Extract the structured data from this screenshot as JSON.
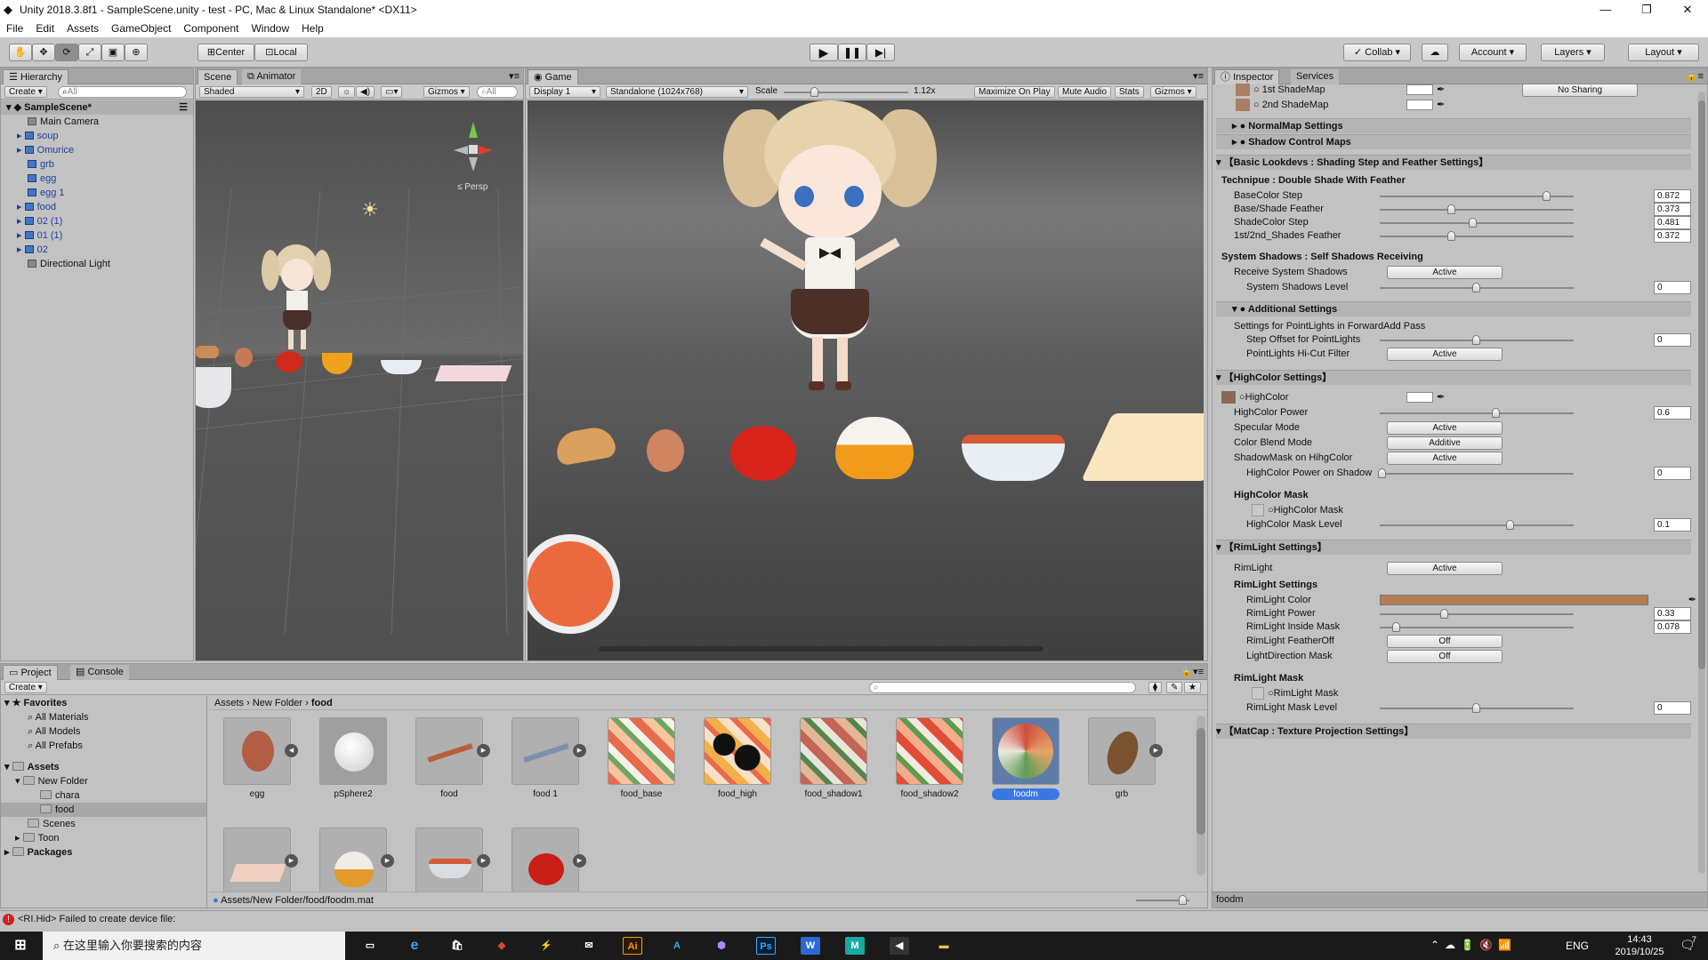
{
  "window": {
    "title": "Unity 2018.3.8f1 - SampleScene.unity - test - PC, Mac & Linux Standalone* <DX11>",
    "min": "—",
    "max": "❐",
    "close": "✕"
  },
  "menu": [
    "File",
    "Edit",
    "Assets",
    "GameObject",
    "Component",
    "Window",
    "Help"
  ],
  "toolbar": {
    "pivot": "Center",
    "space": "Local",
    "collab": "Collab",
    "account": "Account",
    "layers": "Layers",
    "layout": "Layout"
  },
  "hierarchy": {
    "tab": "Hierarchy",
    "create": "Create",
    "search": "All",
    "scene": "SampleScene*",
    "items": [
      "Main Camera",
      "soup",
      "Omurice",
      "grb",
      "egg",
      "egg 1",
      "food",
      "02 (1)",
      "01 (1)",
      "02",
      "Directional Light"
    ]
  },
  "scene": {
    "tab": "Scene",
    "tab2": "Animator",
    "mode": "Shaded",
    "twod": "2D",
    "gizmos": "Gizmos",
    "search": "All",
    "persp": "Persp"
  },
  "game": {
    "tab": "Game",
    "display": "Display 1",
    "res": "Standalone (1024x768)",
    "scale_label": "Scale",
    "scale": "1.12x",
    "maximize": "Maximize On Play",
    "mute": "Mute Audio",
    "stats": "Stats",
    "gizmos": "Gizmos"
  },
  "project": {
    "tab": "Project",
    "tab2": "Console",
    "create": "Create",
    "breadcrumb": [
      "Assets",
      "New Folder",
      "food"
    ],
    "path": "Assets/New Folder/food/foodm.mat",
    "favorites": "Favorites",
    "fav_items": [
      "All Materials",
      "All Models",
      "All Prefabs"
    ],
    "assets_root": "Assets",
    "tree": [
      "New Folder",
      "chara",
      "food",
      "Scenes",
      "Toon"
    ],
    "packages": "Packages",
    "assets": [
      "egg",
      "pSphere2",
      "food",
      "food 1",
      "food_base",
      "food_high",
      "food_shadow1",
      "food_shadow2",
      "foodm",
      "grb"
    ]
  },
  "inspector": {
    "tab": "Inspector",
    "tab2": "Services",
    "footer": "foodm",
    "shademap1": "1st ShadeMap",
    "shademap2": "2nd ShadeMap",
    "nosharing": "No Sharing",
    "normalmap": "● NormalMap Settings",
    "shadowmaps": "● Shadow Control Maps",
    "basic_head": "【Basic Lookdevs : Shading Step and Feather Settings】",
    "technique": "Technipue : Double Shade With Feather",
    "basecolor_step": "BaseColor Step",
    "basecolor_step_v": "0.872",
    "base_shade_feather": "Base/Shade Feather",
    "base_shade_feather_v": "0.373",
    "shadecolor_step": "ShadeColor Step",
    "shadecolor_step_v": "0.481",
    "shades_feather": "1st/2nd_Shades Feather",
    "shades_feather_v": "0.372",
    "sys_head": "System Shadows : Self Shadows Receiving",
    "receive": "Receive System Shadows",
    "active": "Active",
    "sys_level": "System Shadows Level",
    "sys_level_v": "0",
    "additional": "● Additional Settings",
    "pointlights": "Settings for PointLights in ForwardAdd Pass",
    "step_offset": "Step Offset for PointLights",
    "step_offset_v": "0",
    "hicut": "PointLights Hi-Cut Filter",
    "highcolor_head": "【HighColor Settings】",
    "highcolor": "HighColor",
    "hc_power": "HighColor Power",
    "hc_power_v": "0.6",
    "specular": "Specular Mode",
    "blend": "Color Blend Mode",
    "additive": "Additive",
    "shadowmask": "ShadowMask on HihgColor",
    "hc_on_shadow": "HighColor Power on Shadow",
    "hc_on_shadow_v": "0",
    "hc_mask_head": "HighColor Mask",
    "hc_mask": "HighColor Mask",
    "hc_mask_level": "HighColor Mask Level",
    "hc_mask_level_v": "0.1",
    "rim_head": "【RimLight Settings】",
    "rimlight": "RimLight",
    "rim_settings": "RimLight Settings",
    "rim_color": "RimLight Color",
    "rim_power": "RimLight Power",
    "rim_power_v": "0.33",
    "rim_inside": "RimLight Inside Mask",
    "rim_inside_v": "0.078",
    "rim_featheroff": "RimLight FeatherOff",
    "off": "Off",
    "light_dir": "LightDirection Mask",
    "rim_mask_head": "RimLight Mask",
    "rim_mask": "RimLight Mask",
    "rim_mask_level": "RimLight Mask Level",
    "rim_mask_level_v": "0",
    "matcap_head": "【MatCap : Texture Projection Settings】"
  },
  "status": {
    "error": "<RI.Hid> Failed to create device file:"
  },
  "taskbar": {
    "search": "在这里输入你要搜索的内容",
    "lang": "ENG",
    "time": "14:43",
    "date": "2019/10/25",
    "badge": "7"
  },
  "colors": {
    "rim": "#b57d55",
    "accent": "#3a78e0"
  }
}
